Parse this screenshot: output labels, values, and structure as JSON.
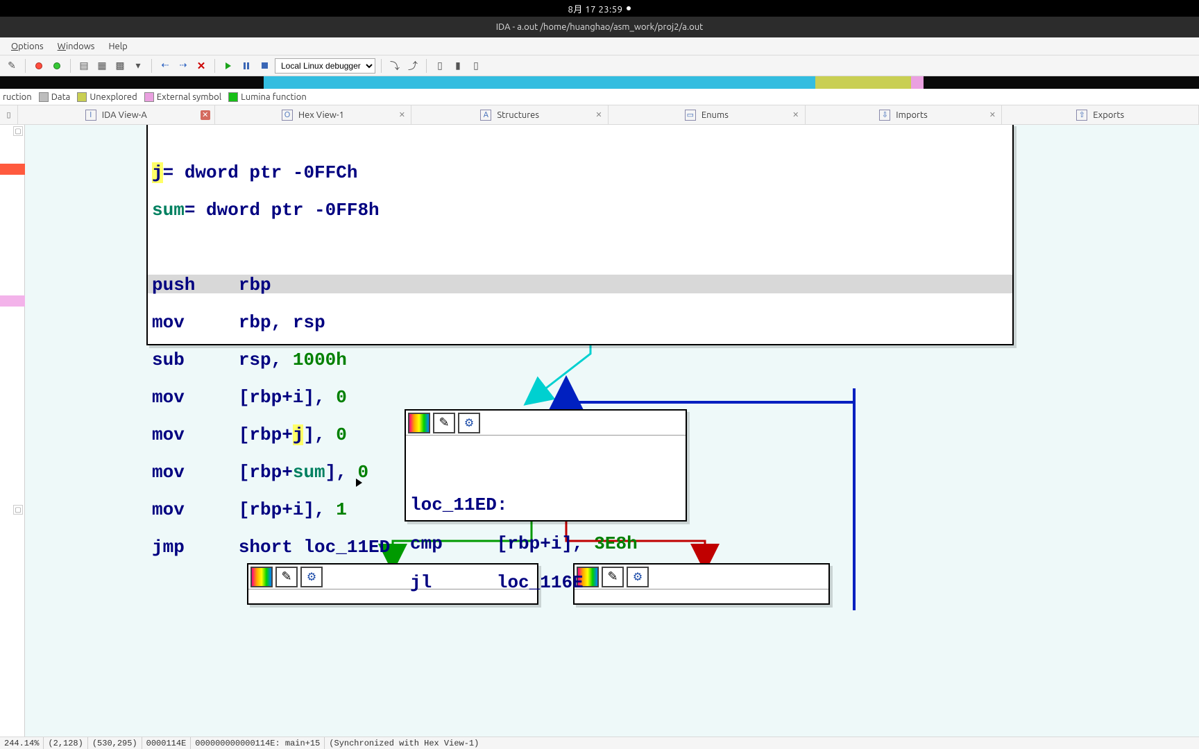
{
  "gnome": {
    "clock": "8月 17 23:59"
  },
  "title": "IDA - a.out /home/huanghao/asm_work/proj2/a.out",
  "menu": {
    "options": "Options",
    "windows": "Windows",
    "help": "Help"
  },
  "toolbar": {
    "debugger": "Local Linux debugger"
  },
  "legend": {
    "instruction": "ruction",
    "data": "Data",
    "unexplored": "Unexplored",
    "external": "External symbol",
    "lumina": "Lumina function"
  },
  "tabs": {
    "ida_view": "IDA View-A",
    "hex_view": "Hex View-1",
    "structures": "Structures",
    "enums": "Enums",
    "imports": "Imports",
    "exports": "Exports"
  },
  "node1": {
    "l1a": "j",
    "l1b": "= dword ptr -0FFCh",
    "l2a": "sum",
    "l2b": "= dword ptr -0FF8h",
    "i1m": "push",
    "i1o": "rbp",
    "i2m": "mov",
    "i2o1": "rbp",
    "i2o2": "rsp",
    "i3m": "sub",
    "i3o1": "rsp",
    "i3o2": "1000h",
    "i4m": "mov",
    "i4o1": "[rbp+i]",
    "i4o2": "0",
    "i5m": "mov",
    "i5o1a": "[rbp+",
    "i5o1b": "j",
    "i5o1c": "]",
    "i5o2": "0",
    "i6m": "mov",
    "i6o1a": "[rbp+",
    "i6o1b": "sum",
    "i6o1c": "]",
    "i6o2": "0",
    "i7m": "mov",
    "i7o1": "[rbp+i]",
    "i7o2": "1",
    "i8m": "jmp",
    "i8o": "short loc_11ED"
  },
  "node2": {
    "loc": "loc_11ED:",
    "i1m": "cmp",
    "i1o1": "[rbp+i]",
    "i1o2": "3E8h",
    "i2m": "jl",
    "i2o": "loc_116E"
  },
  "status": {
    "zoom": "244.14%",
    "xy1": "(2,128)",
    "xy2": "(530,295)",
    "off": "0000114E",
    "addr": "000000000000114E: main+15",
    "sync": "(Synchronized with Hex View-1)"
  }
}
